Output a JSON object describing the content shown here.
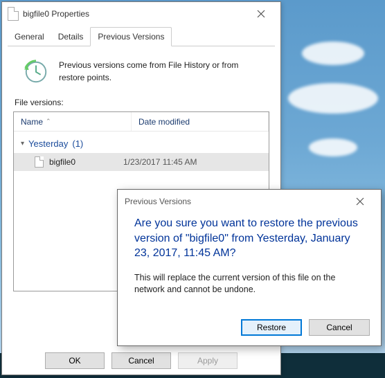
{
  "window": {
    "title": "bigfile0 Properties",
    "tabs": [
      "General",
      "Details",
      "Previous Versions"
    ],
    "active_tab": 2,
    "description": "Previous versions come from File History or from restore points.",
    "file_versions_label": "File versions:",
    "columns": {
      "name": "Name",
      "date": "Date modified"
    },
    "group": {
      "label": "Yesterday",
      "count": "(1)"
    },
    "rows": [
      {
        "name": "bigfile0",
        "date": "1/23/2017 11:45 AM"
      }
    ],
    "buttons": {
      "ok": "OK",
      "cancel": "Cancel",
      "apply": "Apply"
    }
  },
  "dialog": {
    "title": "Previous Versions",
    "main_text": "Are you sure you want to restore the previous version of \"bigfile0\" from Yesterday, January 23, 2017, 11:45 AM?",
    "secondary_text": "This will replace the current version of this file on the network and cannot be undone.",
    "restore": "Restore",
    "cancel": "Cancel"
  }
}
